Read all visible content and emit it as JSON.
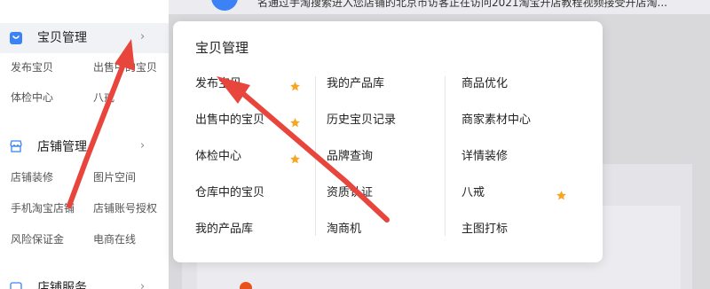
{
  "background": {
    "marquee_text": "名通过手淘搜索进入您店铺的北京市访客正在访问2021淘宝开店教程视频接受开店淘..."
  },
  "sidebar": {
    "sections": [
      {
        "title": "宝贝管理",
        "icon": "shopping-bag-icon",
        "links": [
          "发布宝贝",
          "出售中的宝贝",
          "体检中心",
          "八戒"
        ]
      },
      {
        "title": "店铺管理",
        "icon": "store-icon",
        "links": [
          "店铺装修",
          "图片空间",
          "手机淘宝店铺",
          "店铺账号授权",
          "风险保证金",
          "电商在线"
        ]
      },
      {
        "title": "店铺服务",
        "icon": "service-icon",
        "links": []
      }
    ],
    "chevron": "›"
  },
  "popover": {
    "title": "宝贝管理",
    "columns": [
      [
        {
          "label": "发布宝贝",
          "starred": true
        },
        {
          "label": "出售中的宝贝",
          "starred": true
        },
        {
          "label": "体检中心",
          "starred": true
        },
        {
          "label": "仓库中的宝贝",
          "starred": false
        },
        {
          "label": "我的产品库",
          "starred": false
        }
      ],
      [
        {
          "label": "我的产品库",
          "starred": false
        },
        {
          "label": "历史宝贝记录",
          "starred": false
        },
        {
          "label": "品牌查询",
          "starred": false
        },
        {
          "label": "资质认证",
          "starred": false
        },
        {
          "label": "淘商机",
          "starred": false
        }
      ],
      [
        {
          "label": "商品优化",
          "starred": false
        },
        {
          "label": "商家素材中心",
          "starred": false
        },
        {
          "label": "详情装修",
          "starred": false
        },
        {
          "label": "八戒",
          "starred": true
        },
        {
          "label": "主图打标",
          "starred": false
        }
      ]
    ]
  },
  "colors": {
    "accent_blue": "#3b82f6",
    "star_orange": "#f5a623",
    "arrow_red": "#e8453c"
  }
}
